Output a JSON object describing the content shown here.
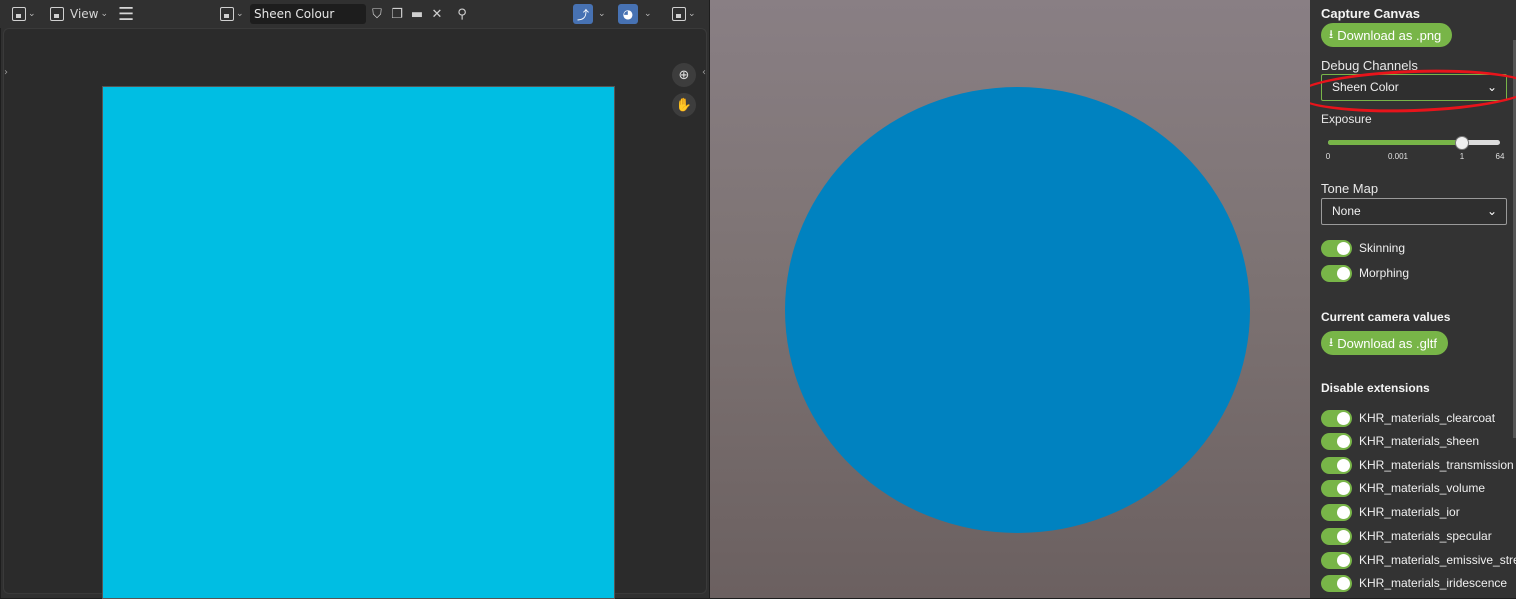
{
  "blender": {
    "header": {
      "view_menu": "View",
      "image_name": "Sheen Colour"
    },
    "canvas_color": "#00bee3"
  },
  "viewer": {
    "sphere_color": "#0082c0"
  },
  "panel": {
    "capture": {
      "title": "Capture Canvas",
      "download_label": "Download as .png"
    },
    "debug": {
      "title": "Debug Channels",
      "selected": "Sheen Color"
    },
    "exposure": {
      "title": "Exposure",
      "ticks": [
        "0",
        "0.001",
        "1",
        "64"
      ],
      "level": 0.78
    },
    "tone_map": {
      "title": "Tone Map",
      "selected": "None"
    },
    "toggles": [
      {
        "label": "Skinning",
        "on": true
      },
      {
        "label": "Morphing",
        "on": true
      }
    ],
    "camera": {
      "title": "Current camera values",
      "download_label": "Download as .gltf"
    },
    "extensions": {
      "title": "Disable extensions",
      "items": [
        "KHR_materials_clearcoat",
        "KHR_materials_sheen",
        "KHR_materials_transmission",
        "KHR_materials_volume",
        "KHR_materials_ior",
        "KHR_materials_specular",
        "KHR_materials_emissive_streng",
        "KHR_materials_iridescence"
      ]
    },
    "accent_color": "#78b548",
    "annotation_color": "#e8141b"
  }
}
